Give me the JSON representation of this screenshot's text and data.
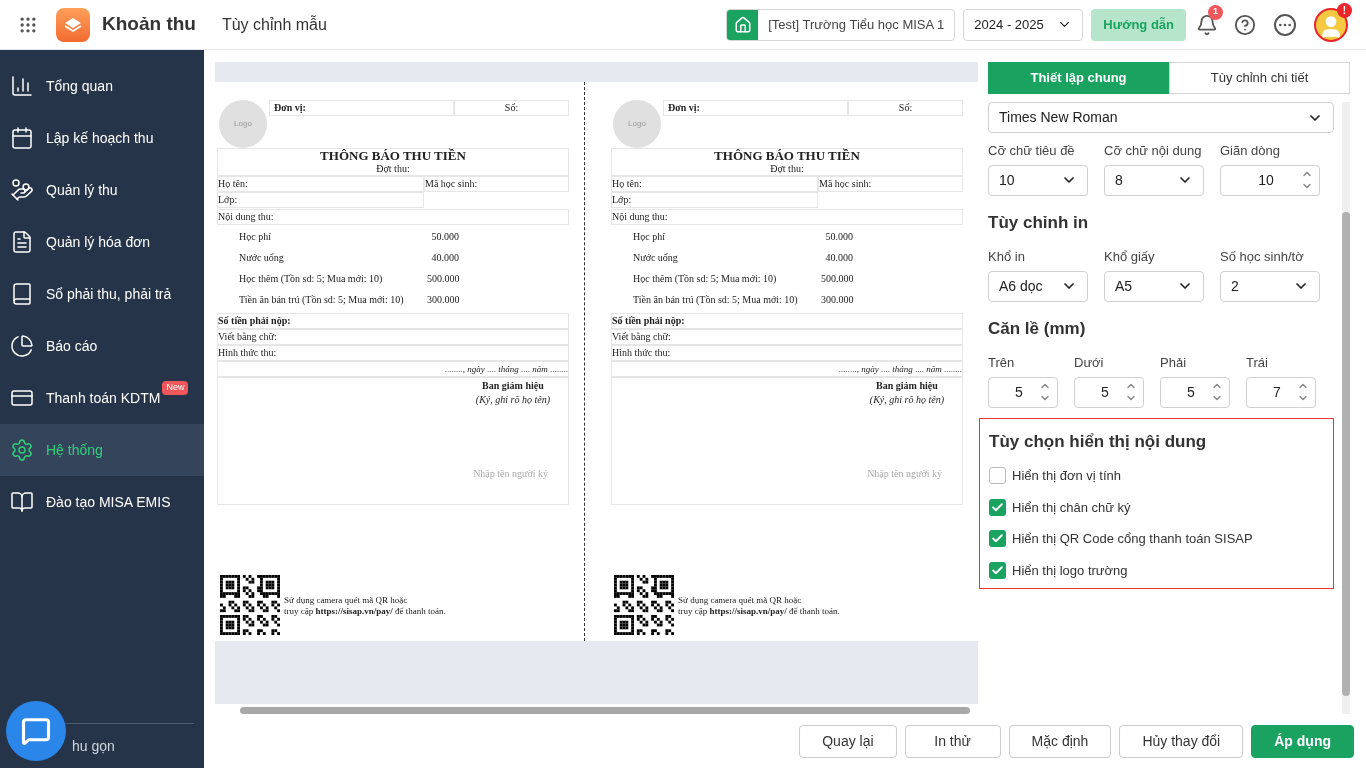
{
  "header": {
    "app_title": "Khoản thu",
    "page_title": "Tùy chỉnh mẫu",
    "school": "[Test] Trường Tiểu học MISA 1",
    "year": "2024 - 2025",
    "guide_button": "Hướng dẫn",
    "notification_count": "1",
    "avatar_badge": "!"
  },
  "sidebar": {
    "items": [
      {
        "label": "Tổng quan",
        "selected": false
      },
      {
        "label": "Lập kế hoạch thu",
        "selected": false
      },
      {
        "label": "Quản lý thu",
        "selected": false
      },
      {
        "label": "Quản lý hóa đơn",
        "selected": false
      },
      {
        "label": "Sổ phải thu, phải trả",
        "selected": false
      },
      {
        "label": "Báo cáo",
        "selected": false
      },
      {
        "label": "Thanh toán KDTM",
        "selected": false,
        "badge": "New"
      },
      {
        "label": "Hệ thống",
        "selected": true
      },
      {
        "label": "Đào tạo MISA EMIS",
        "selected": false
      }
    ],
    "collapse": "hu gọn"
  },
  "receipts": [
    {
      "logo": "Logo",
      "unit_label": "Đơn vị:",
      "number_label": "Số:",
      "title": "THÔNG BÁO THU TIỀN",
      "period": "Đợt thu:",
      "name_label": "Họ tên:",
      "student_code_label": "Mã học sinh:",
      "class_label": "Lớp:",
      "content_label": "Nội dung thu:",
      "fees": [
        {
          "name": "Học phí",
          "amount": "50.000"
        },
        {
          "name": "Nước uống",
          "amount": "40.000"
        },
        {
          "name": "Học thêm (Tồn sd: 5; Mua mới: 10)",
          "amount": "500.000"
        },
        {
          "name": "Tiền ăn bán trú (Tồn sd: 5; Mua mới: 10)",
          "amount": "300.000"
        }
      ],
      "total_label": "Số tiền phải nộp:",
      "in_words_label": "Viết bằng chữ:",
      "method_label": "Hình thức thu:",
      "date_line": "........, *ngày* .... *tháng* .... *năm* ........",
      "signer_title": "Ban giám hiệu",
      "signer_hint": "(Ký, ghi rõ họ tên)",
      "signer_placeholder": "Nhập tên người ký",
      "qr_lines": [
        "Sử dụng camera quét mã QR hoặc",
        "truy cập **https://sisap.vn/pay/** để thanh toán."
      ]
    },
    {
      "logo": "Logo",
      "unit_label": "Đơn vị:",
      "number_label": "Số:",
      "title": "THÔNG BÁO THU TIỀN",
      "period": "Đợt thu:",
      "name_label": "Họ tên:",
      "student_code_label": "Mã học sinh:",
      "class_label": "Lớp:",
      "content_label": "Nội dung thu:",
      "fees": [
        {
          "name": "Học phí",
          "amount": "50.000"
        },
        {
          "name": "Nước uống",
          "amount": "40.000"
        },
        {
          "name": "Học thêm (Tồn sd: 5; Mua mới: 10)",
          "amount": "500.000"
        },
        {
          "name": "Tiền ăn bán trú (Tồn sd: 5; Mua mới: 10)",
          "amount": "300.000"
        }
      ],
      "total_label": "Số tiền phải nộp:",
      "in_words_label": "Viết bằng chữ:",
      "method_label": "Hình thức thu:",
      "date_line": "........, *ngày* .... *tháng* .... *năm* ........",
      "signer_title": "Ban giám hiệu",
      "signer_hint": "(Ký, ghi rõ họ tên)",
      "signer_placeholder": "Nhập tên người ký",
      "qr_lines": [
        "Sử dụng camera quét mã QR hoặc",
        "truy cập **https://sisap.vn/pay/** để thanh toán."
      ]
    }
  ],
  "settings": {
    "tabs": [
      {
        "label": "Thiết lập chung",
        "selected": true
      },
      {
        "label": "Tùy chỉnh chi tiết",
        "selected": false
      }
    ],
    "font": "Times New Roman",
    "font_fields": [
      {
        "label": "Cỡ chữ tiêu đề",
        "value": "10",
        "kind": "select"
      },
      {
        "label": "Cỡ chữ nội dung",
        "value": "8",
        "kind": "select"
      },
      {
        "label": "Giãn dòng",
        "value": "10",
        "kind": "spinner"
      }
    ],
    "print_title": "Tùy chỉnh in",
    "print_fields": [
      {
        "label": "Khổ in",
        "value": "A6 dọc"
      },
      {
        "label": "Khổ giấy",
        "value": "A5"
      },
      {
        "label": "Số học sinh/tờ",
        "value": "2"
      }
    ],
    "margin_title": "Căn lề (mm)",
    "margins": [
      {
        "label": "Trên",
        "value": "5"
      },
      {
        "label": "Dưới",
        "value": "5"
      },
      {
        "label": "Phải",
        "value": "5"
      },
      {
        "label": "Trái",
        "value": "7"
      }
    ],
    "display": {
      "title": "Tùy chọn hiển thị nội dung",
      "highlighted": true,
      "options": [
        {
          "label": "Hiển thị đơn vị tính",
          "checked": false
        },
        {
          "label": "Hiển thị chân chữ ký",
          "checked": true
        },
        {
          "label": "Hiển thị QR Code cổng thanh toán SISAP",
          "checked": true
        },
        {
          "label": "Hiển thị logo trường",
          "checked": true
        }
      ]
    }
  },
  "footer_buttons": [
    {
      "label": "Quay lại",
      "kind": "default"
    },
    {
      "label": "In thử",
      "kind": "default"
    },
    {
      "label": "Mặc định",
      "kind": "default"
    },
    {
      "label": "Hủy thay đổi",
      "kind": "default"
    },
    {
      "label": "Áp dụng",
      "kind": "primary"
    }
  ]
}
